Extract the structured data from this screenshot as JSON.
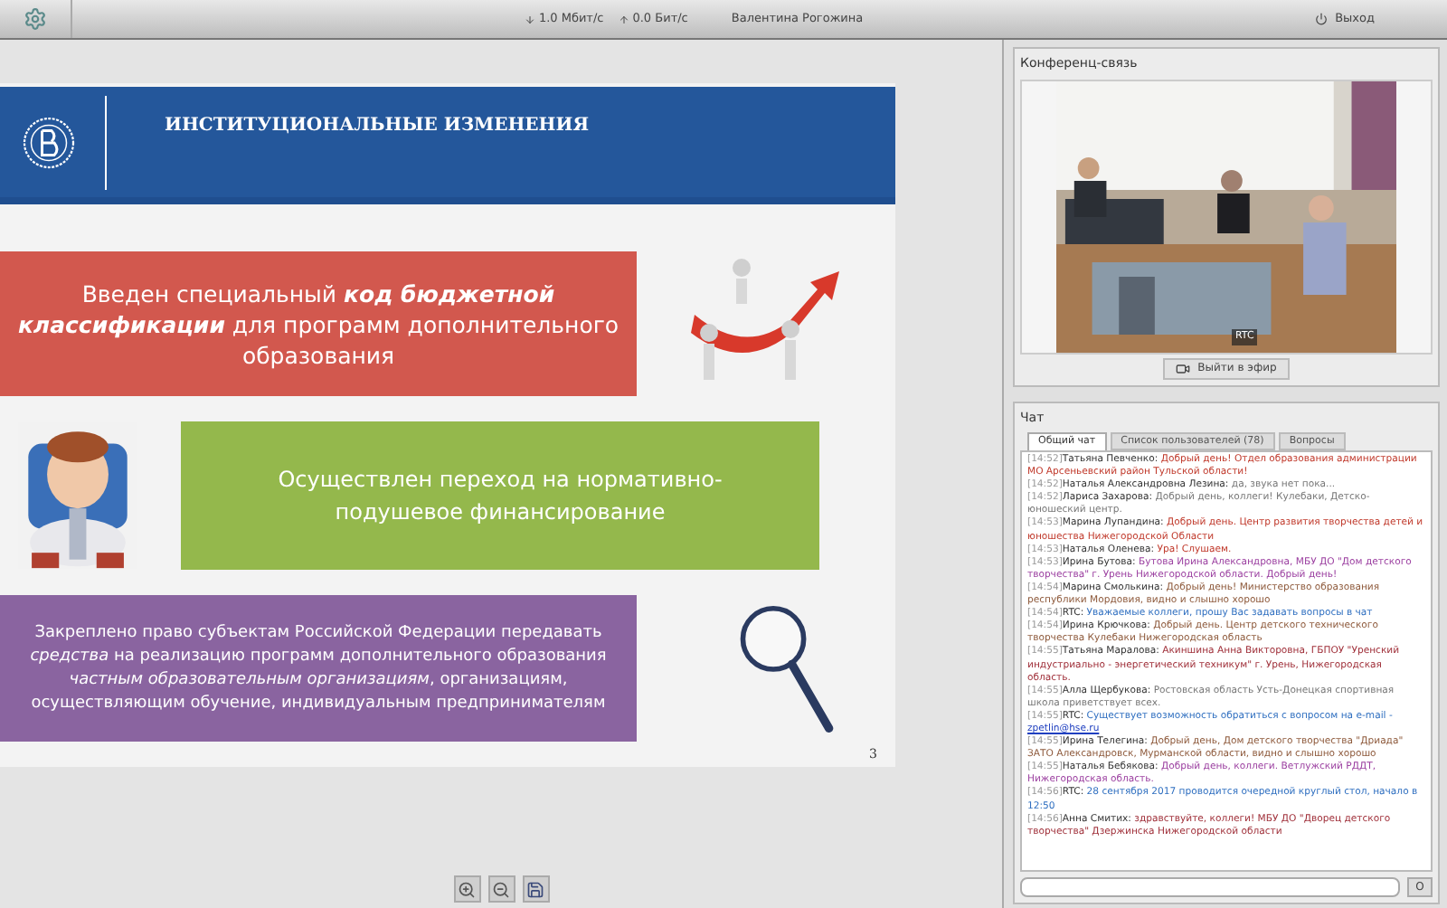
{
  "top_bar": {
    "download": "1.0 Мбит/с",
    "upload": "0.0 Бит/с",
    "user": "Валентина Рогожина",
    "logout": "Выход"
  },
  "slide": {
    "title": "ИНСТИТУЦИОНАЛЬНЫЕ ИЗМЕНЕНИЯ",
    "blocks": [
      {
        "text": "Введен специальный *код бюджетной классификации* для программ дополнительного образования",
        "color": "#d2584e"
      },
      {
        "text": "Осуществлен переход на нормативно-подушевое финансирование",
        "color": "#94b84c"
      },
      {
        "text": "Закреплено право субъектам Российской Федерации передавать *средства* на реализацию программ дополнительного образования  *частным образовательным организациям*, организациям, осуществляющим обучение, индивидуальным предпринимателям",
        "color": "#8a64a0"
      }
    ],
    "page_number": "3"
  },
  "conference": {
    "title": "Конференц-связь",
    "video_label": "RTC",
    "button": "Выйти в эфир"
  },
  "chat": {
    "title": "Чат",
    "tabs": [
      {
        "label": "Общий чат",
        "selected": true
      },
      {
        "label": "Список пользователей (78)",
        "selected": false
      },
      {
        "label": "Вопросы",
        "selected": false
      }
    ],
    "messages": [
      {
        "time": "[14:52]",
        "author": "Татьяна Певченко:",
        "text": "Добрый день! Отдел образования администрации МО Арсеньевский район Тульской области!",
        "color": "#c0392b"
      },
      {
        "time": "[14:52]",
        "author": "Наталья Александровна Лезина:",
        "text": "да, звука нет пока...",
        "color": "#777777"
      },
      {
        "time": "[14:52]",
        "author": "Лариса Захарова:",
        "text": "Добрый день, коллеги! Кулебаки, Детско-юношеский центр.",
        "color": "#777777"
      },
      {
        "time": "[14:53]",
        "author": "Марина Лупандина:",
        "text": "Добрый день. Центр развития творчества детей и юношества Нижегородской Области",
        "color": "#c0392b"
      },
      {
        "time": "[14:53]",
        "author": "Наталья Оленева:",
        "text": "Ура! Слушаем.",
        "color": "#c0392b"
      },
      {
        "time": "[14:53]",
        "author": "Ирина Бутова:",
        "text": "Бутова Ирина Александровна, МБУ ДО \"Дом детского творчества\" г. Урень Нижегородской области. Добрый день!",
        "color": "#9b3fa0"
      },
      {
        "time": "[14:54]",
        "author": "Марина Смолькина:",
        "text": "Добрый день! Министерство образования республики Мордовия, видно и слышно хорошо",
        "color": "#8e5a3c"
      },
      {
        "time": "[14:54]",
        "author": "RTC:",
        "text": "Уважаемые коллеги, прошу Вас задавать вопросы в чат",
        "color": "#2f6fc0"
      },
      {
        "time": "[14:54]",
        "author": "Ирина Крючкова:",
        "text": "Добрый день. Центр детского технического творчества Кулебаки Нижегородская область",
        "color": "#8e5a3c"
      },
      {
        "time": "[14:55]",
        "author": "Татьяна Маралова:",
        "text": "Акиншина Анна Викторовна, ГБПОУ \"Уренский индустриально - энергетический техникум\" г. Урень, Нижегородская область.",
        "color": "#a0303a"
      },
      {
        "time": "[14:55]",
        "author": "Алла Щербукова:",
        "text": "Ростовская область Усть-Донецкая спортивная школа приветствует всех.",
        "color": "#777777"
      },
      {
        "time": "[14:55]",
        "author": "RTC:",
        "text": "Существует возможность обратиться с вопросом на e-mail -",
        "link": "zpetlin@hse.ru",
        "color": "#2f6fc0"
      },
      {
        "time": "[14:55]",
        "author": "Ирина Телегина:",
        "text": "Добрый день, Дом детского творчества \"Дриада\" ЗАТО Александровск, Мурманской области, видно и слышно хорошо",
        "color": "#8e5a3c"
      },
      {
        "time": "[14:55]",
        "author": "Наталья Бебякова:",
        "text": "Добрый день, коллеги. Ветлужский РДДТ, Нижегородская область.",
        "color": "#9b3fa0"
      },
      {
        "time": "[14:56]",
        "author": "RTC:",
        "text": "28 сентября 2017 проводится очередной круглый стол, начало в 12:50",
        "color": "#2f6fc0"
      },
      {
        "time": "[14:56]",
        "author": "Анна Смитих:",
        "text": "здравствуйте, коллеги! МБУ ДО \"Дворец детского творчества\" Дзержинска Нижегородской области",
        "color": "#a0303a"
      }
    ],
    "send_button": "О"
  }
}
